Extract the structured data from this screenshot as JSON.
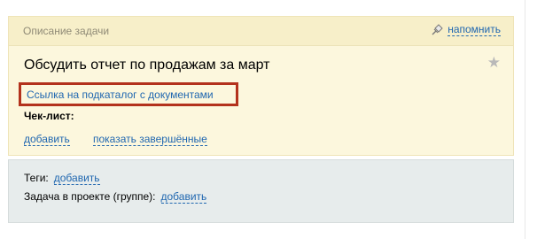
{
  "task": {
    "header_label": "Описание задачи",
    "remind_label": "напомнить",
    "title": "Обсудить отчет по продажам за март",
    "doc_link": "Ссылка на подкаталог с документами",
    "checklist_label": "Чек-лист:",
    "add_label": "добавить",
    "show_done_label": "показать завершённые"
  },
  "tags_panel": {
    "tags_label": "Теги:",
    "tags_add": "добавить",
    "project_label": "Задача в проекте (группе):",
    "project_add": "добавить"
  },
  "icons": {
    "remind": "pushpin-icon",
    "favorite": "star-icon"
  },
  "colors": {
    "link": "#2067b0",
    "highlight_border": "#b3321c",
    "card_bg": "#fcf7dd",
    "panel_bg": "#e7ecec"
  }
}
